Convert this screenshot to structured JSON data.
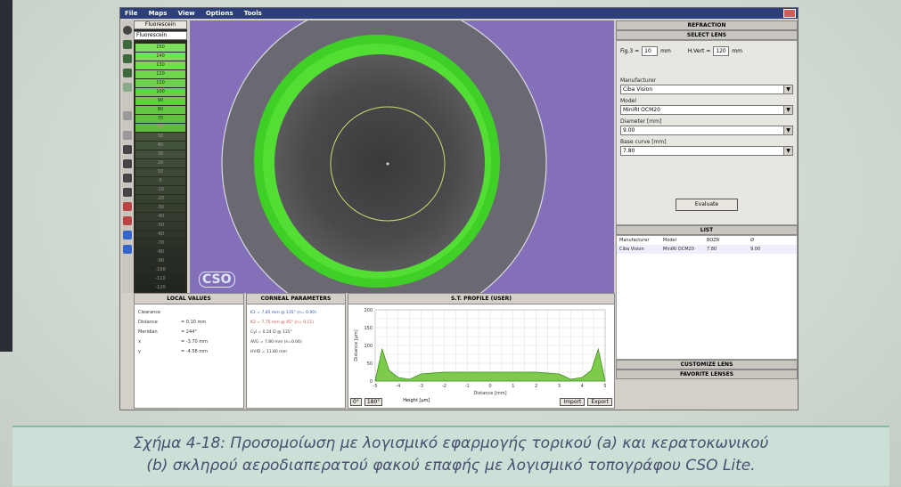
{
  "menu": [
    "File",
    "Maps",
    "View",
    "Options",
    "Tools"
  ],
  "palette": {
    "mode_button": "Fluorescein",
    "select_value": "Fluorescein",
    "unit": "μm",
    "scale": [
      "150",
      "140",
      "130",
      "120",
      "110",
      "100",
      "90",
      "80",
      "70",
      "60",
      "50",
      "40",
      "30",
      "20",
      "10",
      "0",
      "-10",
      "-20",
      "-30",
      "-40",
      "-50",
      "-60",
      "-70",
      "-80",
      "-90",
      "-100",
      "-110",
      "-120"
    ]
  },
  "map": {
    "logo": "CSO"
  },
  "local_values": {
    "title": "LOCAL VALUES",
    "rows": [
      {
        "label": "Clearance",
        "value": ""
      },
      {
        "label": "Distance",
        "value": "= 0.10 mm"
      },
      {
        "label": "Meridian",
        "value": "= 244°"
      },
      {
        "label": "x",
        "value": "= -3.70 mm"
      },
      {
        "label": "y",
        "value": "= -4.58 mm"
      }
    ]
  },
  "corneal": {
    "title": "CORNEAL PARAMETERS",
    "rows": [
      "K1 = 7.85 mm @ 135° (n= 0.00)",
      "K2 = 7.75 mm @ 45° (n= 0.11)",
      "Cyl = 0.24 D @ 135°",
      "AVG = 7.80 mm (n=0.06)",
      "HVID = 11.80 mm"
    ]
  },
  "profile": {
    "title": "S.T. PROFILE (USER)",
    "ylabel": "Distance [μm]",
    "xlabel": "Distance [mm]",
    "yticks": [
      "200",
      "150",
      "100",
      "50",
      "0"
    ],
    "xticks": [
      "-5",
      "-4",
      "-3",
      "-2",
      "-1",
      "0",
      "1",
      "2",
      "3",
      "4",
      "5"
    ],
    "footer_left": [
      "0°",
      "180°"
    ],
    "footer_mid": "Height [μm]",
    "footer_right": [
      "Import",
      "Export"
    ]
  },
  "chart_data": {
    "type": "area",
    "x": [
      -5,
      -4.7,
      -4.4,
      -4,
      -3.5,
      -3,
      -2,
      -1,
      0,
      1,
      2,
      3,
      3.5,
      4,
      4.4,
      4.7,
      5
    ],
    "values": [
      0,
      90,
      30,
      10,
      5,
      20,
      25,
      25,
      25,
      25,
      25,
      20,
      5,
      10,
      30,
      90,
      0
    ],
    "xlabel": "Distance [mm]",
    "ylabel": "Distance [μm]",
    "ylim": [
      0,
      200
    ],
    "xlim": [
      -5,
      5
    ],
    "grid": true
  },
  "right": {
    "refraction": "REFRACTION",
    "select_lens": "SELECT LENS",
    "fit": {
      "label1": "Fig.3 =",
      "val1": "10",
      "unit1": "mm",
      "label2": "H.Vert =",
      "val2": "120",
      "unit2": "mm"
    },
    "manufacturer": {
      "label": "Manufacturer",
      "value": "Ciba Vision"
    },
    "model": {
      "label": "Model",
      "value": "MiniRI OCM20"
    },
    "diameter": {
      "label": "Diameter [mm]",
      "value": "9.00"
    },
    "base_curve": {
      "label": "Base curve [mm]",
      "value": "7.80"
    },
    "evaluate": "Evaluate",
    "list_header": "LIST",
    "table_headers": [
      "Manufacturer",
      "Model",
      "BOZR",
      "Ø"
    ],
    "table_row": [
      "Ciba Vision",
      "MiniRI OCM20",
      "7.80",
      "9.00"
    ],
    "customize": "CUSTOMIZE LENS",
    "favorite": "FAVORITE LENSES"
  },
  "caption": {
    "line1": "Σχήμα 4-18: Προσομοίωση με λογισμικό εφαρμογής τορικού (a) και κερατοκωνικού",
    "line2": "(b) σκληρού αεροδιαπερατού φακού επαφής με λογισμικό τοπογράφου CSO Lite."
  },
  "colors": {
    "map_bg": "#8470b8",
    "ring": "#4ee02a",
    "titlebar": "#2c3f7a",
    "caption_bg": "#cbe0d6"
  }
}
